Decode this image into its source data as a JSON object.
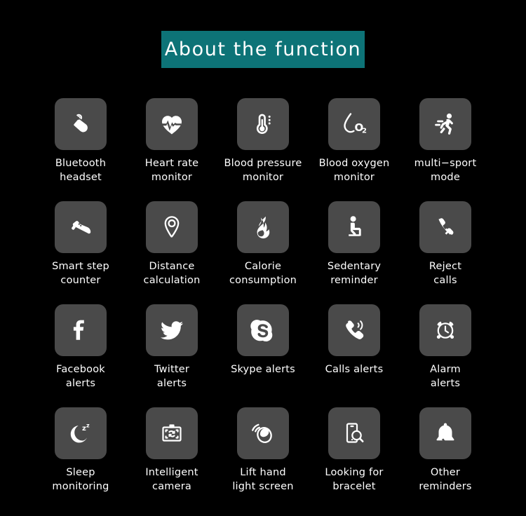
{
  "header": {
    "title": "About  the  function",
    "background_color": "#0d7377",
    "text_color": "#ffffff"
  },
  "theme": {
    "page_background": "#000000",
    "tile_background": "#4a4a4a",
    "icon_color": "#ffffff",
    "caption_color": "#ffffff",
    "accent": "#0d7377"
  },
  "grid": {
    "columns": 5,
    "rows": 4,
    "features": [
      {
        "icon": "bluetooth-headset-icon",
        "label": "Bluetooth\nheadset"
      },
      {
        "icon": "heart-rate-icon",
        "label": "Heart  rate\nmonitor"
      },
      {
        "icon": "thermometer-blood-pressure-icon",
        "label": "Blood  pressure\nmonitor"
      },
      {
        "icon": "blood-oxygen-o2-icon",
        "label": "Blood  oxygen\nmonitor"
      },
      {
        "icon": "running-multi-sport-icon",
        "label": "multi−sport\nmode"
      },
      {
        "icon": "shoe-step-counter-icon",
        "label": "Smart  step\ncounter"
      },
      {
        "icon": "location-pin-icon",
        "label": "Distance\ncalculation"
      },
      {
        "icon": "flame-calorie-icon",
        "label": "Calorie\nconsumption"
      },
      {
        "icon": "sitting-person-sedentary-icon",
        "label": "Sedentary\nreminder"
      },
      {
        "icon": "phone-reject-call-icon",
        "label": "Reject\ncalls"
      },
      {
        "icon": "facebook-icon",
        "label": "Facebook\nalerts"
      },
      {
        "icon": "twitter-bird-icon",
        "label": "Twitter\nalerts"
      },
      {
        "icon": "skype-icon",
        "label": "Skype  alerts"
      },
      {
        "icon": "phone-ringing-call-icon",
        "label": "Calls  alerts"
      },
      {
        "icon": "alarm-clock-icon",
        "label": "Alarm\nalerts"
      },
      {
        "icon": "moon-sleep-icon",
        "label": "Sleep\nmonitoring"
      },
      {
        "icon": "camera-remote-icon",
        "label": "Intelligent\ncamera"
      },
      {
        "icon": "lift-hand-light-screen-icon",
        "label": "Lift  hand\nlight  screen"
      },
      {
        "icon": "find-bracelet-search-icon",
        "label": "Looking  for\nbracelet"
      },
      {
        "icon": "bell-reminder-icon",
        "label": "Other\nreminders"
      }
    ]
  }
}
